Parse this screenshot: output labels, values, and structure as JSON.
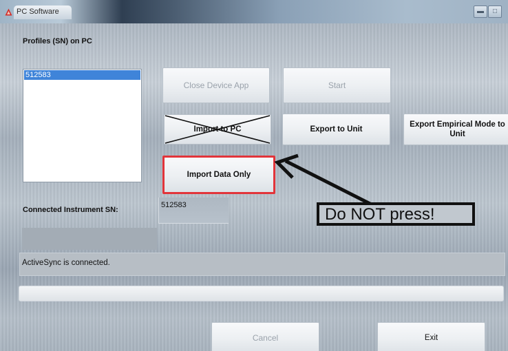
{
  "window": {
    "title": "PC Software",
    "controls": [
      "minimize",
      "maximize"
    ]
  },
  "profiles": {
    "label": "Profiles (SN) on PC",
    "items": [
      "512583"
    ],
    "selected": "512583"
  },
  "buttons": {
    "close_device_app": "Close Device App",
    "start": "Start",
    "import_to_pc": "Import to PC",
    "export_to_unit": "Export to Unit",
    "export_empirical": "Export Empirical Mode to Unit",
    "import_data_only": "Import Data Only",
    "cancel": "Cancel",
    "exit": "Exit"
  },
  "instrument": {
    "label": "Connected Instrument SN:",
    "sn": "512583"
  },
  "annotation": {
    "warning": "Do NOT press!",
    "highlight_color": "#e2343a"
  },
  "status": {
    "text": "ActiveSync is connected."
  },
  "icons": {
    "app_logo": "red-triangle-logo-icon"
  }
}
